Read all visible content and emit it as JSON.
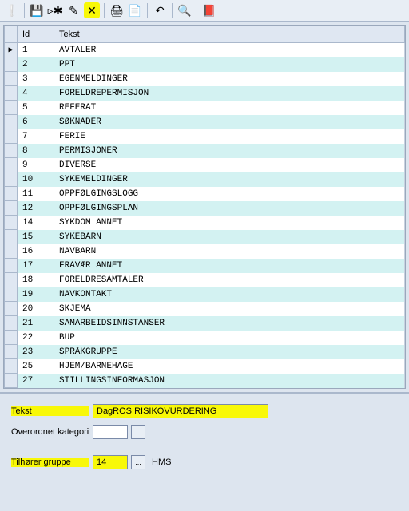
{
  "toolbar": {
    "icons": [
      "❕",
      "💾",
      "▹✱",
      "✎",
      "✕",
      "🖨",
      "📄",
      "↶",
      "🔍",
      "📕"
    ]
  },
  "grid": {
    "headers": {
      "id": "Id",
      "tekst": "Tekst"
    },
    "rows": [
      {
        "id": "1",
        "tekst": "AVTALER",
        "sel": "▶"
      },
      {
        "id": "2",
        "tekst": "PPT"
      },
      {
        "id": "3",
        "tekst": "EGENMELDINGER"
      },
      {
        "id": "4",
        "tekst": "FORELDREPERMISJON"
      },
      {
        "id": "5",
        "tekst": "REFERAT"
      },
      {
        "id": "6",
        "tekst": "SØKNADER"
      },
      {
        "id": "7",
        "tekst": "FERIE"
      },
      {
        "id": "8",
        "tekst": "PERMISJONER"
      },
      {
        "id": "9",
        "tekst": "DIVERSE"
      },
      {
        "id": "10",
        "tekst": "SYKEMELDINGER"
      },
      {
        "id": "11",
        "tekst": "OPPFØLGINGSLOGG"
      },
      {
        "id": "12",
        "tekst": "OPPFØLGINGSPLAN"
      },
      {
        "id": "14",
        "tekst": "SYKDOM ANNET"
      },
      {
        "id": "15",
        "tekst": "SYKEBARN"
      },
      {
        "id": "16",
        "tekst": "NAVBARN"
      },
      {
        "id": "17",
        "tekst": "FRAVÆR ANNET"
      },
      {
        "id": "18",
        "tekst": "FORELDRESAMTALER"
      },
      {
        "id": "19",
        "tekst": "NAVKONTAKT"
      },
      {
        "id": "20",
        "tekst": "SKJEMA"
      },
      {
        "id": "21",
        "tekst": "SAMARBEIDSINNSTANSER"
      },
      {
        "id": "22",
        "tekst": "BUP"
      },
      {
        "id": "23",
        "tekst": "SPRÅKGRUPPE"
      },
      {
        "id": "25",
        "tekst": "HJEM/BARNEHAGE"
      },
      {
        "id": "27",
        "tekst": "STILLINGSINFORMASJON"
      }
    ]
  },
  "form": {
    "tekst_label": "Tekst",
    "tekst_value": "DagROS RISIKOVURDERING",
    "overordnet_label": "Overordnet kategori",
    "overordnet_value": "",
    "gruppe_label": "Tilhører gruppe",
    "gruppe_value": "14",
    "gruppe_text": "HMS",
    "ellipsis": "..."
  }
}
